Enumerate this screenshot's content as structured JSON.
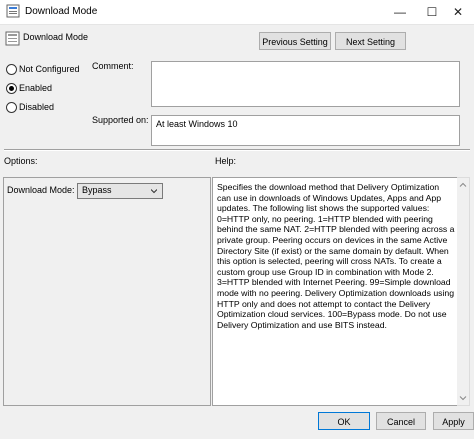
{
  "window": {
    "title": "Download Mode",
    "minimize_glyph": "—",
    "maximize_glyph": "☐",
    "close_glyph": "✕"
  },
  "header": {
    "title": "Download Mode",
    "prev_label": "Previous Setting",
    "next_label": "Next Setting"
  },
  "state": {
    "options": [
      {
        "label": "Not Configured",
        "selected": false
      },
      {
        "label": "Enabled",
        "selected": true
      },
      {
        "label": "Disabled",
        "selected": false
      }
    ]
  },
  "comment": {
    "label": "Comment:",
    "value": ""
  },
  "supported": {
    "label": "Supported on:",
    "value": "At least Windows 10"
  },
  "options_pane": {
    "heading": "Options:",
    "download_mode_label": "Download Mode:",
    "download_mode_value": "Bypass"
  },
  "help": {
    "heading": "Help:",
    "text": "Specifies the download method that Delivery Optimization can use in downloads of Windows Updates, Apps and App updates. The following list shows the supported values: 0=HTTP only, no peering. 1=HTTP blended with peering behind the same NAT. 2=HTTP blended with peering across a private group. Peering occurs on devices in the same Active Directory Site (if exist) or the same domain by default. When this option is selected, peering will cross NATs. To create a custom group use Group ID in combination with Mode 2. 3=HTTP blended with Internet Peering. 99=Simple download mode with no peering. Delivery Optimization downloads using HTTP only and does not attempt to contact the Delivery Optimization cloud services. 100=Bypass mode. Do not use Delivery Optimization and use BITS instead."
  },
  "footer": {
    "ok_label": "OK",
    "cancel_label": "Cancel",
    "apply_label": "Apply"
  },
  "icons": {
    "title": "policy-icon",
    "header": "policy-setting-icon",
    "dropdown": "chevron-down-icon",
    "scroll_up": "scroll-up-arrow-icon",
    "scroll_down": "scroll-down-arrow-icon"
  }
}
